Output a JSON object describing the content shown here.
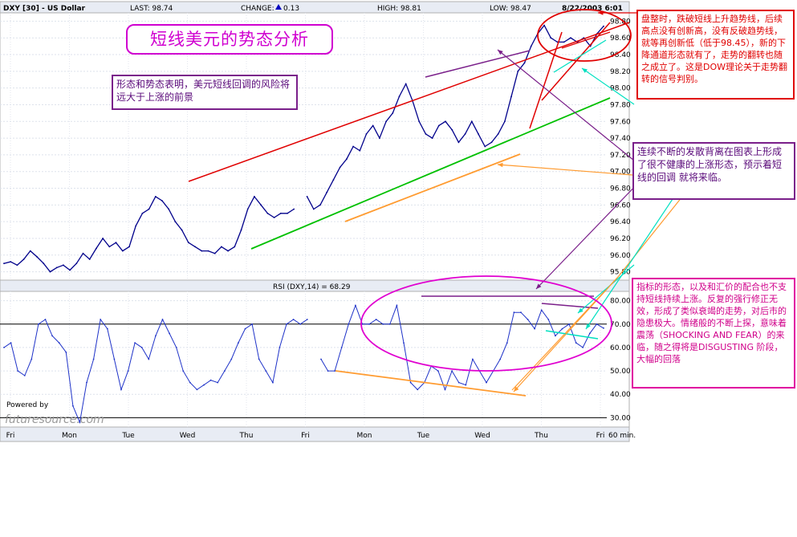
{
  "header": {
    "symbol": "DXY [30] - US Dollar",
    "last": "LAST: 98.74",
    "change_label": "CHANGE:",
    "change_value": "0.13",
    "high": "HIGH: 98.81",
    "low": "LOW: 98.47",
    "date": "8/22/2003 6:01"
  },
  "rsi_label": "RSI (DXY,14) = 68.29",
  "watermark": "futuresource.com",
  "watermark_small": "Powered by",
  "interval": "60 min.",
  "annotations": {
    "title": "短线美元的势态分析",
    "left": "形态和势态表明，美元短线回调的风险将远大于上涨的前景",
    "red": "盘整时，跌破短线上升趋势线，后续高点没有创新高，没有反破趋势线，就等再创新低（低于98.45），新的下降通道形态就有了，走势的翻转也随之成立了。这是DOW理论关于走势翻转的信号判别。",
    "purple": "连续不断的发散背离在图表上形成了很不健康的上涨形态，预示着短线的回调 就将来临。",
    "magenta": "指标的形态，以及和汇价的配合也不支持短线持续上涨。反复的强行修正无效，形成了类似衰竭的走势，对后市的隐患极大。情绪般的不断上探，意味着震荡（SHOCKING AND FEAR）的来临，随之得将是DISGUSTING 阶段，大幅的回落"
  },
  "colors": {
    "price": "#00008b",
    "rsi": "#1e32c8",
    "trend_red": "#e00000",
    "trend_green": "#00c000",
    "orange": "#ff9b30",
    "purple": "#7a1f8a",
    "cyan": "#00e0c0",
    "magenta": "#e000d0"
  },
  "chart_data": [
    {
      "type": "line",
      "title": "DXY [30] - US Dollar",
      "x_labels": [
        "Fri",
        "Mon",
        "Tue",
        "Wed",
        "Thu",
        "Fri",
        "Mon",
        "Tue",
        "Wed",
        "Thu",
        "Fri"
      ],
      "y_ticks": [
        95.8,
        96.0,
        96.2,
        96.4,
        96.6,
        96.8,
        97.0,
        97.2,
        97.4,
        97.6,
        97.8,
        98.0,
        98.2,
        98.4,
        98.6,
        98.8
      ],
      "ylim": [
        95.7,
        98.9
      ],
      "series": [
        {
          "values": [
            95.9,
            95.92,
            95.88,
            95.95,
            96.05,
            95.98,
            95.9,
            95.8,
            95.85,
            95.88,
            95.82,
            95.9,
            96.02,
            95.95,
            96.08,
            96.2,
            96.1,
            96.15,
            96.05,
            96.1,
            96.35,
            96.5,
            96.55,
            96.7,
            96.65,
            96.55,
            96.4,
            96.3,
            96.15,
            96.1,
            96.05,
            96.05,
            96.02,
            96.1,
            96.05,
            96.1,
            96.3,
            96.55,
            96.7,
            96.6,
            96.5,
            96.45,
            96.5,
            96.5,
            96.55,
            null,
            96.7,
            96.55,
            96.6,
            96.75,
            96.9,
            97.05,
            97.15,
            97.3,
            97.25,
            97.45,
            97.55,
            97.4,
            97.6,
            97.7,
            97.9,
            98.05,
            97.85,
            97.6,
            97.45,
            97.4,
            97.55,
            97.6,
            97.5,
            97.35,
            97.45,
            97.6,
            97.45,
            97.3,
            97.35,
            97.45,
            97.6,
            97.9,
            98.2,
            98.3,
            98.5,
            98.65,
            98.75,
            98.6,
            98.55,
            98.55,
            98.6,
            98.55,
            98.6,
            98.5,
            98.65,
            98.74
          ]
        }
      ]
    },
    {
      "type": "line",
      "title": "RSI (DXY,14) = 68.29",
      "y_ticks": [
        30.0,
        40.0,
        50.0,
        60.0,
        70.0,
        80.0
      ],
      "ylim": [
        26,
        84
      ],
      "series": [
        {
          "values": [
            60,
            62,
            50,
            48,
            55,
            70,
            72,
            65,
            62,
            58,
            35,
            28,
            45,
            55,
            72,
            68,
            55,
            42,
            50,
            62,
            60,
            55,
            65,
            72,
            66,
            60,
            50,
            45,
            42,
            44,
            46,
            45,
            50,
            55,
            62,
            68,
            70,
            55,
            50,
            45,
            60,
            70,
            72,
            70,
            72,
            null,
            55,
            50,
            50,
            60,
            70,
            78,
            70,
            70,
            72,
            70,
            70,
            78,
            62,
            45,
            42,
            45,
            52,
            50,
            42,
            50,
            45,
            44,
            55,
            50,
            45,
            50,
            55,
            62,
            75,
            75,
            72,
            68,
            76,
            72,
            65,
            68,
            70,
            62,
            60,
            66,
            70,
            68.29
          ]
        }
      ]
    }
  ]
}
